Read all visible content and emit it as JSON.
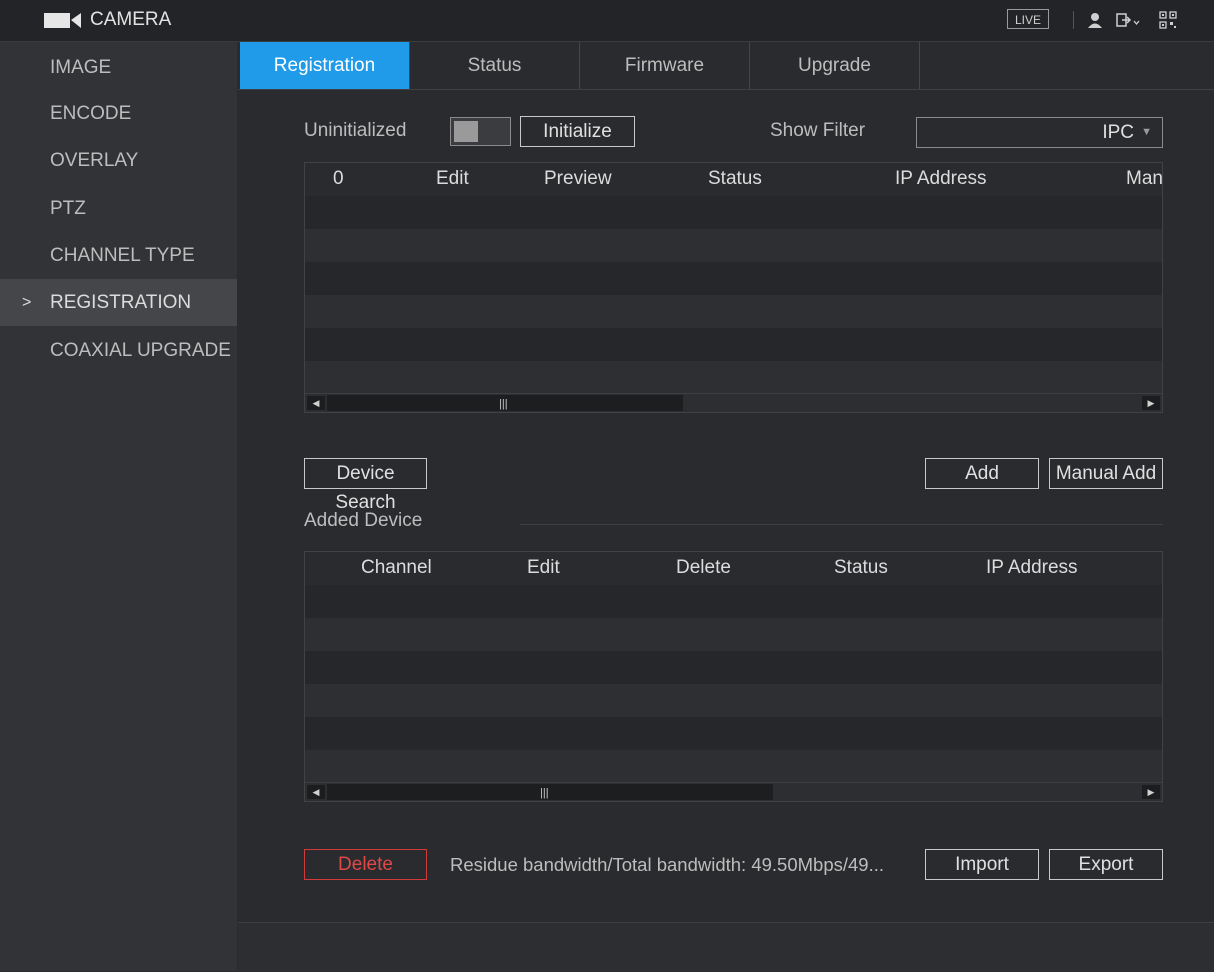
{
  "header": {
    "title": "CAMERA",
    "live_label": "LIVE",
    "icons": [
      "camera-icon",
      "user-icon",
      "logout-icon",
      "qr-code-icon"
    ]
  },
  "sidebar": {
    "items": [
      {
        "label": "IMAGE"
      },
      {
        "label": "ENCODE"
      },
      {
        "label": "OVERLAY"
      },
      {
        "label": "PTZ"
      },
      {
        "label": "CHANNEL TYPE"
      },
      {
        "label": "REGISTRATION",
        "active": true
      },
      {
        "label": "COAXIAL UPGRADE"
      }
    ],
    "active_marker": ">"
  },
  "tabs": [
    {
      "label": "Registration",
      "active": true
    },
    {
      "label": "Status"
    },
    {
      "label": "Firmware"
    },
    {
      "label": "Upgrade"
    }
  ],
  "registration": {
    "uninitialized_label": "Uninitialized",
    "initialize_button": "Initialize",
    "show_filter_label": "Show Filter",
    "filter_value": "IPC",
    "found_table": {
      "columns": [
        "0",
        "Edit",
        "Preview",
        "Status",
        "IP Address",
        "Manu"
      ]
    },
    "device_search_button": "Device Search",
    "add_button": "Add",
    "manual_add_button": "Manual Add",
    "added_device_label": "Added Device",
    "added_table": {
      "columns": [
        "Channel",
        "Edit",
        "Delete",
        "Status",
        "IP Address"
      ]
    },
    "delete_button": "Delete",
    "bandwidth_text": "Residue bandwidth/Total bandwidth:  49.50Mbps/49...",
    "import_button": "Import",
    "export_button": "Export"
  },
  "colors": {
    "accent": "#1f9bea",
    "danger": "#e04848",
    "background": "#2a2b2e"
  }
}
